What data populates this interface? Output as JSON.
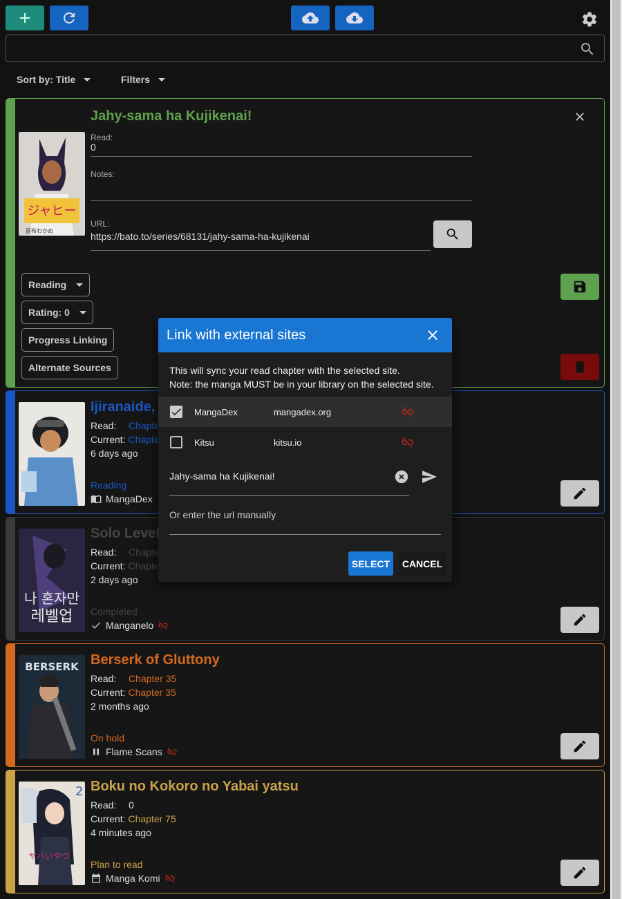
{
  "toolbar": {
    "add_icon": "plus-icon",
    "refresh_icon": "refresh-icon",
    "upload_icon": "cloud-upload-icon",
    "download_icon": "cloud-download-icon",
    "settings_icon": "gear-icon",
    "accent_green": "#1e8c7c",
    "accent_blue": "#1565c0"
  },
  "search": {
    "value": "",
    "placeholder": ""
  },
  "sort": {
    "label": "Sort by: Title"
  },
  "filters": {
    "label": "Filters"
  },
  "edit_card": {
    "title": "Jahy-sama ha Kujikenai!",
    "color": "#5ea14e",
    "read_label": "Read:",
    "read_value": "0",
    "notes_label": "Notes:",
    "notes_value": "",
    "url_label": "URL:",
    "url_value": "https://bato.to/series/68131/jahy-sama-ha-kujikenai",
    "status_select": "Reading",
    "rating_select": "Rating: 0",
    "progress_linking": "Progress Linking",
    "alternate_sources": "Alternate Sources"
  },
  "cards": [
    {
      "title": "Ijiranaide, Nagatoro-san",
      "color": "#1a56c4",
      "read_label": "Read:",
      "read_value": "Chapter",
      "current_label": "Current:",
      "current_value": "Chapter",
      "time": "6 days ago",
      "status": "Reading",
      "source": "MangaDex"
    },
    {
      "title": "Solo Leveling",
      "color": "#3a3a3a",
      "read_label": "Read:",
      "read_value": "Chapter",
      "current_label": "Current:",
      "current_value": "Chapter",
      "time": "2 days ago",
      "status": "Completed",
      "source": "Manganelo"
    },
    {
      "title": "Berserk of Gluttony",
      "color": "#d2691e",
      "read_label": "Read:",
      "read_value": "Chapter 35",
      "current_label": "Current:",
      "current_value": "Chapter 35",
      "time": "2 months ago",
      "status": "On hold",
      "source": "Flame Scans"
    },
    {
      "title": "Boku no Kokoro no Yabai yatsu",
      "color": "#c9a24a",
      "read_label": "Read:",
      "read_value": "0",
      "current_label": "Current:",
      "current_value": "Chapter 75",
      "time": "4 minutes ago",
      "status": "Plan to read",
      "source": "Manga Komi"
    }
  ],
  "modal": {
    "title": "Link with external sites",
    "desc_line1": "This will sync your read chapter with the selected site.",
    "desc_line2": "Note: the manga MUST be in your library on the selected site.",
    "sites": [
      {
        "name": "MangaDex",
        "url": "mangadex.org",
        "checked": true
      },
      {
        "name": "Kitsu",
        "url": "kitsu.io",
        "checked": false
      }
    ],
    "search_value": "Jahy-sama ha Kujikenai!",
    "manual_label": "Or enter the url manually",
    "select_label": "SELECT",
    "cancel_label": "CANCEL"
  }
}
